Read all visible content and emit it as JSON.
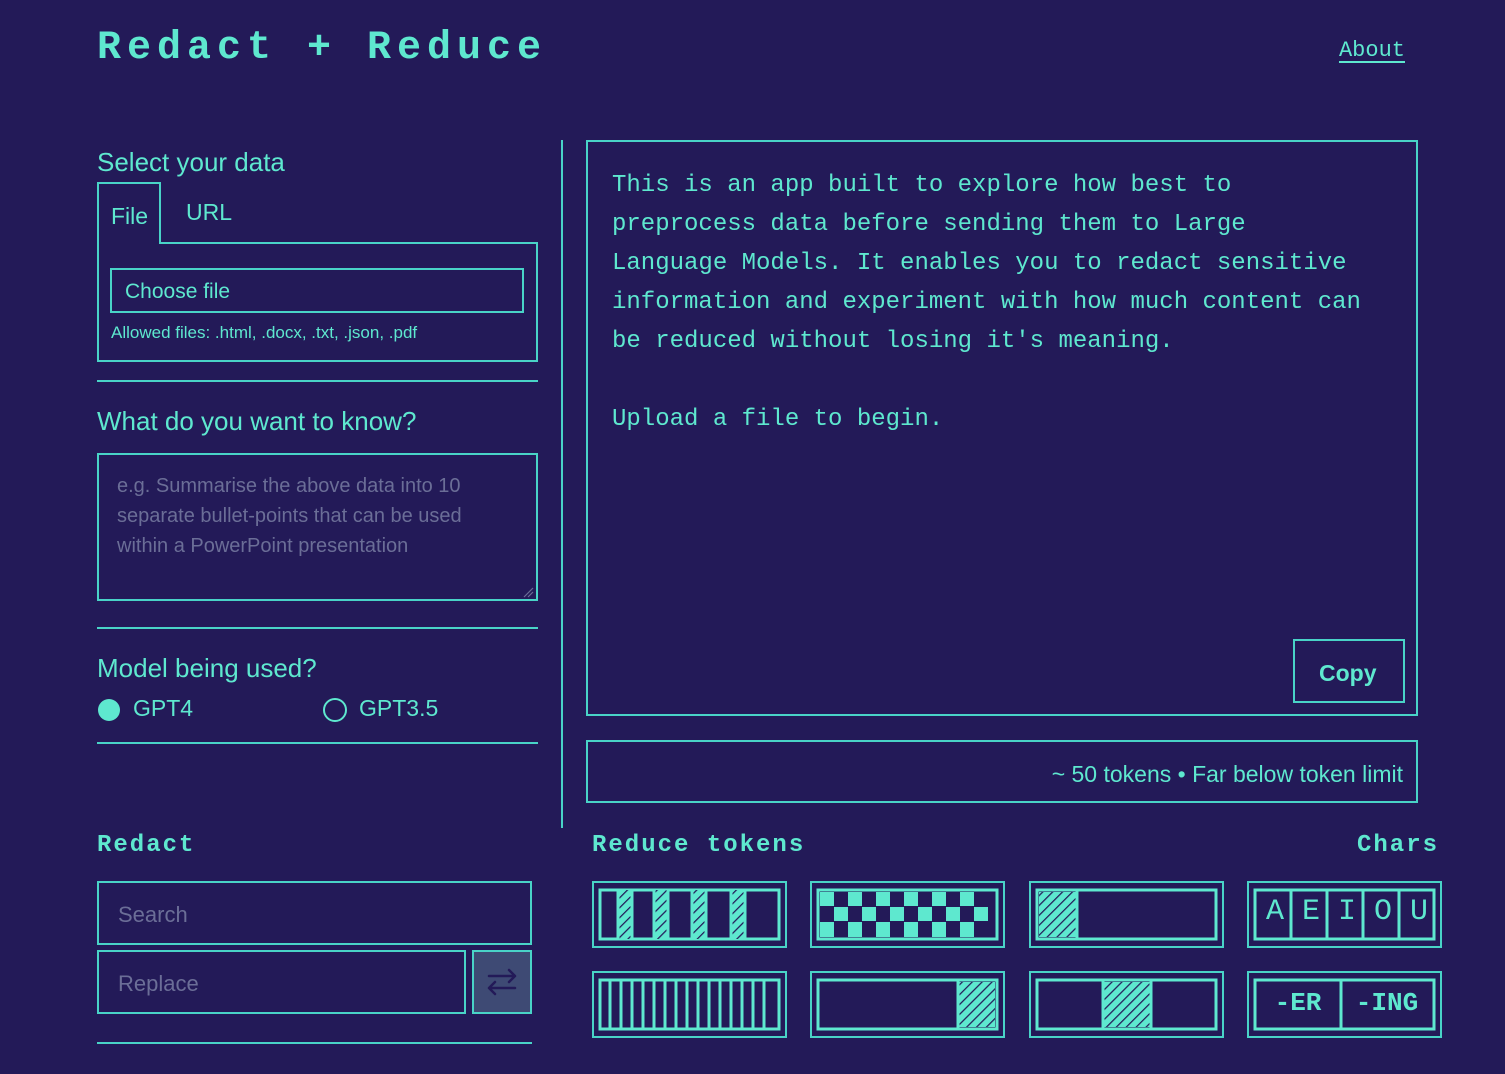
{
  "header": {
    "title": "Redact + Reduce",
    "about_label": "About"
  },
  "data_select": {
    "heading": "Select your data",
    "tabs": [
      {
        "label": "File",
        "active": true
      },
      {
        "label": "URL",
        "active": false
      }
    ],
    "choose_file_label": "Choose file",
    "allowed_files": "Allowed files: .html, .docx, .txt, .json, .pdf"
  },
  "question": {
    "heading": "What do you want to know?",
    "placeholder": "e.g. Summarise the above data into 10 separate bullet-points that can be used within a PowerPoint presentation"
  },
  "model": {
    "heading": "Model being used?",
    "options": [
      {
        "label": "GPT4",
        "selected": true
      },
      {
        "label": "GPT3.5",
        "selected": false
      }
    ]
  },
  "output": {
    "text": "This is an app built to explore how best to\npreprocess data before sending them to Large\nLanguage Models. It enables you to redact sensitive\ninformation and experiment with how much content can\nbe reduced without losing it's meaning.\n\nUpload a file to begin.",
    "copy_label": "Copy",
    "token_status": "~ 50 tokens • Far below token limit"
  },
  "redact": {
    "heading": "Redact",
    "search_placeholder": "Search",
    "replace_placeholder": "Replace",
    "swap_icon": "swap-arrows-icon"
  },
  "reduce": {
    "heading": "Reduce tokens",
    "chars_heading": "Chars",
    "tiles": [
      {
        "name": "stripes-pattern-icon"
      },
      {
        "name": "checker-pattern-icon"
      },
      {
        "name": "start-block-icon"
      },
      {
        "name": "vowels-icon",
        "text": [
          "A",
          "E",
          "I",
          "O",
          "U"
        ]
      },
      {
        "name": "dense-stripes-icon"
      },
      {
        "name": "end-block-icon"
      },
      {
        "name": "middle-block-icon"
      },
      {
        "name": "suffixes-icon",
        "text": [
          "-ER",
          "-ING"
        ]
      }
    ]
  },
  "colors": {
    "background": "#231a58",
    "accent": "#5ee8cf",
    "border": "#49d3c7",
    "placeholder": "#6b6e97",
    "button_bg": "#3e4a74"
  }
}
